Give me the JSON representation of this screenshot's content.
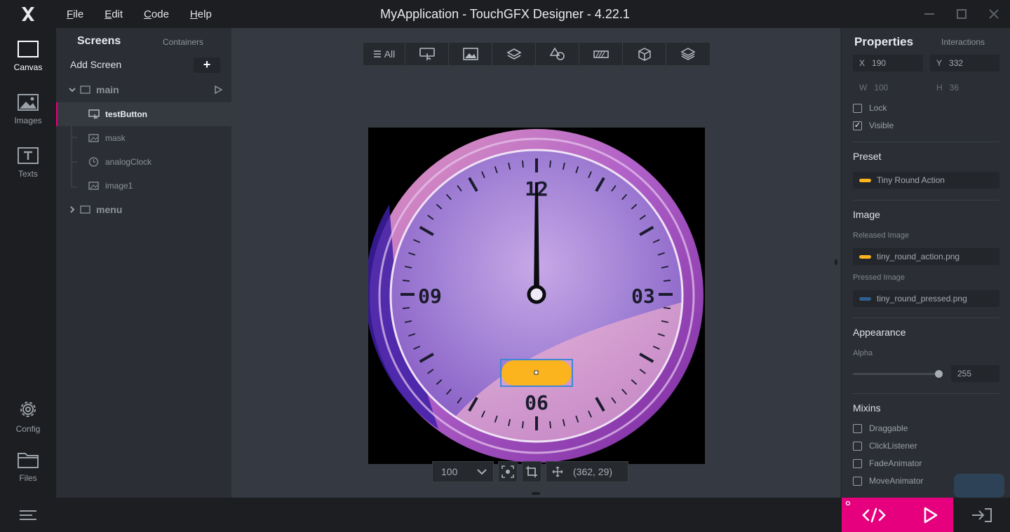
{
  "window": {
    "title": "MyApplication - TouchGFX Designer - 4.22.1"
  },
  "menu": {
    "file": "File",
    "edit": "Edit",
    "code": "Code",
    "help": "Help"
  },
  "nav": {
    "canvas": "Canvas",
    "images": "Images",
    "texts": "Texts",
    "config": "Config",
    "files": "Files"
  },
  "tree": {
    "tab_screens": "Screens",
    "tab_containers": "Containers",
    "add_screen": "Add Screen",
    "screen_main": "main",
    "items": [
      "testButton",
      "mask",
      "analogClock",
      "image1"
    ],
    "screen_menu": "menu"
  },
  "toolbar": {
    "all_label": "All"
  },
  "clock": {
    "n12": "12",
    "n03": "03",
    "n06": "06",
    "n09": "09"
  },
  "zoombar": {
    "zoom": "100",
    "coords": "(362, 29)"
  },
  "properties": {
    "title": "Properties",
    "interactions": "Interactions",
    "x_label": "X",
    "x_value": "190",
    "y_label": "Y",
    "y_value": "332",
    "w_label": "W",
    "w_value": "100",
    "h_label": "H",
    "h_value": "36",
    "lock": "Lock",
    "visible": "Visible",
    "visible_checked": true,
    "preset_header": "Preset",
    "preset_value": "Tiny Round Action",
    "image_header": "Image",
    "released_label": "Released Image",
    "released_value": "tiny_round_action.png",
    "pressed_label": "Pressed Image",
    "pressed_value": "tiny_round_pressed.png",
    "appearance_header": "Appearance",
    "alpha_label": "Alpha",
    "alpha_value": "255",
    "alpha_fraction": 1.0,
    "mixins_header": "Mixins",
    "mixins": [
      "Draggable",
      "ClickListener",
      "FadeAnimator",
      "MoveAnimator"
    ]
  },
  "colors": {
    "accent": "#e6007e",
    "button": "#fbb41e",
    "pressed": "#2f5f8f"
  }
}
